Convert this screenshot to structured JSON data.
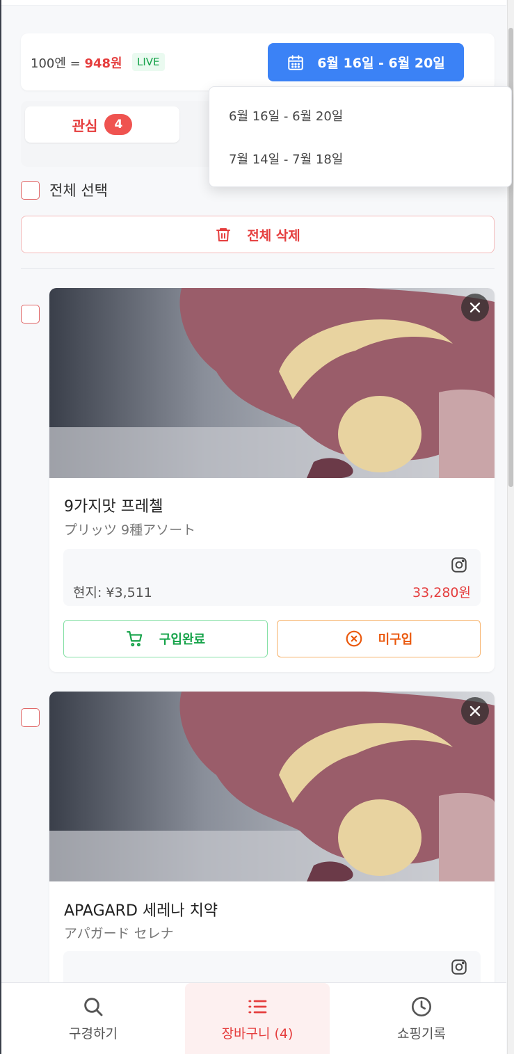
{
  "rate": {
    "prefix": "100엔 = ",
    "value": "948원",
    "live": "LIVE"
  },
  "date_picker": {
    "selected": "6월 16일 - 6월 20일",
    "options": [
      "6월 16일 - 6월 20일",
      "7월 14일 - 7월 18일"
    ]
  },
  "tabs": {
    "favorites_label": "관심",
    "favorites_count": "4"
  },
  "select_all_label": "전체 선택",
  "delete_all_label": "전체 삭제",
  "items": [
    {
      "title": "9가지맛 프레첼",
      "subtitle": "プリッツ 9種アソート",
      "local_price": "현지: ¥3,511",
      "krw_price": "33,280원",
      "bought_label": "구입완료",
      "not_bought_label": "미구입"
    },
    {
      "title": "APAGARD 세레나 치약",
      "subtitle": "アパガード セレナ"
    }
  ],
  "nav": {
    "search": "구경하기",
    "cart": "장바구니 (4)",
    "history": "쇼핑기록"
  },
  "colors": {
    "accent_red": "#e53e3e",
    "primary_blue": "#3b82f6",
    "green": "#16a34a",
    "orange": "#ea580c"
  }
}
